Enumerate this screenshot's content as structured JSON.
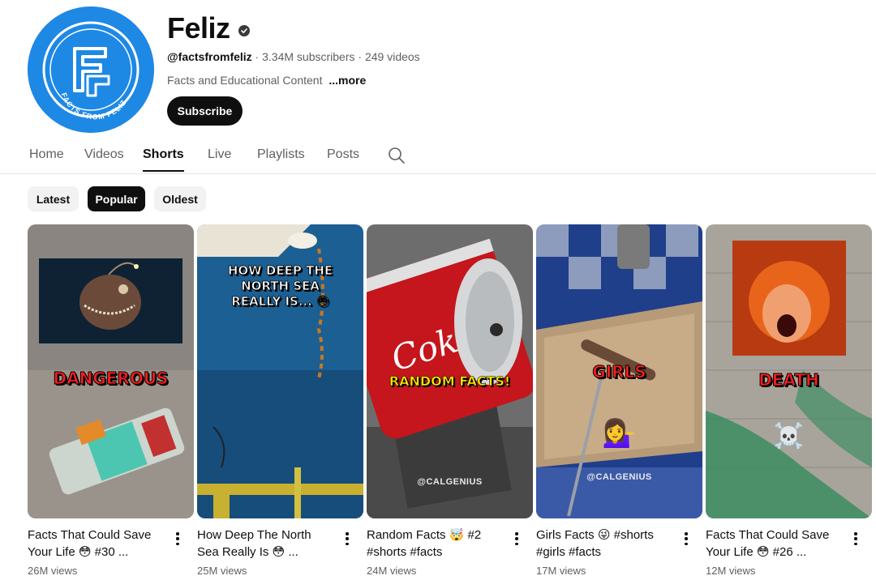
{
  "channel": {
    "name": "Feliz",
    "handle": "@factsfromfeliz",
    "subscribers": "3.34M subscribers",
    "videos": "249 videos",
    "separator": " · ",
    "description": "Facts and Educational Content",
    "more_label": "...more",
    "subscribe_label": "Subscribe",
    "avatar_text": "FACTS FROM FELIZ"
  },
  "tabs": [
    {
      "label": "Home",
      "active": false
    },
    {
      "label": "Videos",
      "active": false
    },
    {
      "label": "Shorts",
      "active": true
    },
    {
      "label": "Live",
      "active": false
    },
    {
      "label": "Playlists",
      "active": false
    },
    {
      "label": "Posts",
      "active": false
    }
  ],
  "chips": [
    {
      "label": "Latest",
      "active": false
    },
    {
      "label": "Popular",
      "active": true
    },
    {
      "label": "Oldest",
      "active": false
    }
  ],
  "shorts": [
    {
      "title_line1": "Facts That Could Save",
      "title_line2": "Your Life 😳 #30 ...",
      "views": "26M views",
      "overlay": "DANGEROUS"
    },
    {
      "title_line1": "How Deep The North",
      "title_line2": "Sea Really Is 😳 ...",
      "views": "25M views",
      "overlay": "HOW DEEP THE NORTH SEA REALLY IS... 😳"
    },
    {
      "title_line1": "Random Facts 🤯 #2",
      "title_line2": "#shorts #facts",
      "views": "24M views",
      "overlay": "RANDOM FACTS!",
      "watermark": "@CALGENIUS"
    },
    {
      "title_line1": "Girls Facts 😜 #shorts",
      "title_line2": "#girls #facts",
      "views": "17M views",
      "overlay": "GIRLS",
      "watermark": "@CALGENIUS",
      "emoji": "💁‍♀️"
    },
    {
      "title_line1": "Facts That Could Save",
      "title_line2": "Your Life 😳 #26 ...",
      "views": "12M views",
      "overlay": "DEATH",
      "emoji": "☠️"
    }
  ],
  "colors": {
    "accent": "#0f0f0f",
    "avatar_bg": "#1e88e5",
    "overlay_red": "#ff1e1e",
    "overlay_yellow": "#ffe600"
  },
  "icons": [
    "verified-badge-icon",
    "search-icon",
    "more-vert-icon"
  ]
}
